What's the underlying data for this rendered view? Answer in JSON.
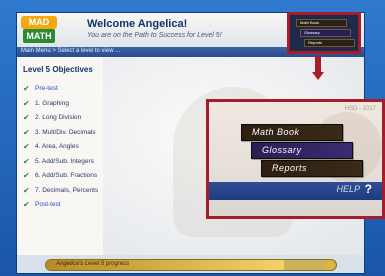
{
  "app": {
    "logo_top": "MAD",
    "logo_bottom": "MATH",
    "welcome": "Welcome Angelica!",
    "subtitle": "You are on the Path to Success for Level 5!",
    "breadcrumb": "Main Menu > Select a level to view ..."
  },
  "objectives": {
    "title": "Level 5 Objectives",
    "items": [
      {
        "label": "Pre-test",
        "link": true
      },
      {
        "label": "1. Graphing",
        "link": false
      },
      {
        "label": "2. Long Division",
        "link": false
      },
      {
        "label": "3. Mult/Div. Decimals",
        "link": false
      },
      {
        "label": "4. Area, Angles",
        "link": false
      },
      {
        "label": "5. Add/Sub. Integers",
        "link": false
      },
      {
        "label": "6. Add/Sub. Fractions",
        "link": false
      },
      {
        "label": "7. Decimals, Percents",
        "link": false
      },
      {
        "label": "Post-test",
        "link": true
      }
    ]
  },
  "footer": {
    "progress_label": "Angelica's Level 5 progress",
    "progress_fraction": 0.82
  },
  "menu": {
    "math_book": "Math Book",
    "glossary": "Glossary",
    "reports": "Reports",
    "help": "HELP",
    "question": "?"
  },
  "zoom": {
    "header": "HSD - 2017"
  }
}
